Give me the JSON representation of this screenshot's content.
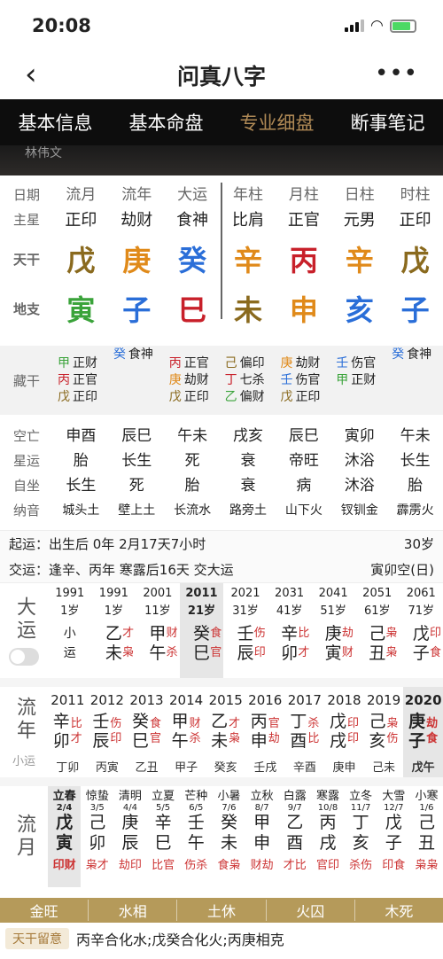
{
  "status": {
    "time": "20:08"
  },
  "nav": {
    "title": "问真八字"
  },
  "tabs": [
    "基本信息",
    "基本命盘",
    "专业细盘",
    "断事笔记"
  ],
  "banner": {
    "name": "林伟文"
  },
  "header": {
    "labels": [
      "日期",
      "流月",
      "流年",
      "大运",
      "年柱",
      "月柱",
      "日柱",
      "时柱"
    ]
  },
  "zhuxing": {
    "label": "主星",
    "values": [
      "正印",
      "劫财",
      "食神",
      "比肩",
      "正官",
      "元男",
      "正印"
    ]
  },
  "tiangan": {
    "label": "天干",
    "values": [
      "戊",
      "庚",
      "癸",
      "辛",
      "丙",
      "辛",
      "戊"
    ]
  },
  "dizhi": {
    "label": "地支",
    "values": [
      "寅",
      "子",
      "巳",
      "未",
      "申",
      "亥",
      "子"
    ]
  },
  "canggan": {
    "label": "藏干",
    "cols": [
      [
        [
          "甲",
          "正财"
        ],
        [
          "丙",
          "正官"
        ],
        [
          "戊",
          "正印"
        ]
      ],
      [
        [
          "癸",
          "食神"
        ]
      ],
      [
        [
          "丙",
          "正官"
        ],
        [
          "庚",
          "劫财"
        ],
        [
          "戊",
          "正印"
        ]
      ],
      [
        [
          "己",
          "偏印"
        ],
        [
          "丁",
          "七杀"
        ],
        [
          "乙",
          "偏财"
        ]
      ],
      [
        [
          "庚",
          "劫财"
        ],
        [
          "壬",
          "伤官"
        ],
        [
          "戊",
          "正印"
        ]
      ],
      [
        [
          "壬",
          "伤官"
        ],
        [
          "甲",
          "正财"
        ]
      ],
      [
        [
          "癸",
          "食神"
        ]
      ]
    ]
  },
  "kongwang": {
    "label": "空亡",
    "values": [
      "申酉",
      "辰巳",
      "午未",
      "戌亥",
      "辰巳",
      "寅卯",
      "午未"
    ]
  },
  "xingyun": {
    "label": "星运",
    "values": [
      "胎",
      "长生",
      "死",
      "衰",
      "帝旺",
      "沐浴",
      "长生"
    ]
  },
  "zizuo": {
    "label": "自坐",
    "values": [
      "长生",
      "死",
      "胎",
      "衰",
      "病",
      "沐浴",
      "胎"
    ]
  },
  "nayin": {
    "label": "纳音",
    "values": [
      "城头土",
      "壁上土",
      "长流水",
      "路旁土",
      "山下火",
      "钗钏金",
      "霹雳火"
    ]
  },
  "qiyun": {
    "line1": "起运：出生后 0年 2月17天7小时",
    "age": "30岁",
    "line2": "交运：逢辛、丙年 寒露后16天 交大运",
    "kong": "寅卯空(日)"
  },
  "dayun": {
    "title": "大运",
    "items": [
      {
        "year": "1991",
        "age": "1岁",
        "g": "小",
        "z": "运",
        "sg": "",
        "sz": ""
      },
      {
        "year": "1991",
        "age": "1岁",
        "g": "乙",
        "z": "未",
        "sg": "才",
        "sz": "枭"
      },
      {
        "year": "2001",
        "age": "11岁",
        "g": "甲",
        "z": "午",
        "sg": "财",
        "sz": "杀"
      },
      {
        "year": "2011",
        "age": "21岁",
        "g": "癸",
        "z": "巳",
        "sg": "食",
        "sz": "官"
      },
      {
        "year": "2021",
        "age": "31岁",
        "g": "壬",
        "z": "辰",
        "sg": "伤",
        "sz": "印"
      },
      {
        "year": "2031",
        "age": "41岁",
        "g": "辛",
        "z": "卯",
        "sg": "比",
        "sz": "才"
      },
      {
        "year": "2041",
        "age": "51岁",
        "g": "庚",
        "z": "寅",
        "sg": "劫",
        "sz": "财"
      },
      {
        "year": "2051",
        "age": "61岁",
        "g": "己",
        "z": "丑",
        "sg": "枭",
        "sz": "枭"
      },
      {
        "year": "2061",
        "age": "71岁",
        "g": "戊",
        "z": "子",
        "sg": "印",
        "sz": "食"
      }
    ]
  },
  "liunian": {
    "title": "流年",
    "sub": "小运",
    "items": [
      {
        "year": "2011",
        "g": "辛",
        "z": "卯",
        "sg": "比",
        "sz": "才",
        "x": "丁卯"
      },
      {
        "year": "2012",
        "g": "壬",
        "z": "辰",
        "sg": "伤",
        "sz": "印",
        "x": "丙寅"
      },
      {
        "year": "2013",
        "g": "癸",
        "z": "巳",
        "sg": "食",
        "sz": "官",
        "x": "乙丑"
      },
      {
        "year": "2014",
        "g": "甲",
        "z": "午",
        "sg": "财",
        "sz": "杀",
        "x": "甲子"
      },
      {
        "year": "2015",
        "g": "乙",
        "z": "未",
        "sg": "才",
        "sz": "枭",
        "x": "癸亥"
      },
      {
        "year": "2016",
        "g": "丙",
        "z": "申",
        "sg": "官",
        "sz": "劫",
        "x": "壬戌"
      },
      {
        "year": "2017",
        "g": "丁",
        "z": "酉",
        "sg": "杀",
        "sz": "比",
        "x": "辛酉"
      },
      {
        "year": "2018",
        "g": "戊",
        "z": "戌",
        "sg": "印",
        "sz": "印",
        "x": "庚申"
      },
      {
        "year": "2019",
        "g": "己",
        "z": "亥",
        "sg": "枭",
        "sz": "伤",
        "x": "己未"
      },
      {
        "year": "2020",
        "g": "庚",
        "z": "子",
        "sg": "劫",
        "sz": "食",
        "x": "戊午"
      }
    ]
  },
  "liuyue": {
    "title": "流月",
    "items": [
      {
        "jie": "立春",
        "d": "2/4",
        "g": "戊",
        "z": "寅",
        "s": "印财"
      },
      {
        "jie": "惊蛰",
        "d": "3/5",
        "g": "己",
        "z": "卯",
        "s": "枭才"
      },
      {
        "jie": "清明",
        "d": "4/4",
        "g": "庚",
        "z": "辰",
        "s": "劫印"
      },
      {
        "jie": "立夏",
        "d": "5/5",
        "g": "辛",
        "z": "巳",
        "s": "比官"
      },
      {
        "jie": "芒种",
        "d": "6/5",
        "g": "壬",
        "z": "午",
        "s": "伤杀"
      },
      {
        "jie": "小暑",
        "d": "7/6",
        "g": "癸",
        "z": "未",
        "s": "食枭"
      },
      {
        "jie": "立秋",
        "d": "8/7",
        "g": "甲",
        "z": "申",
        "s": "财劫"
      },
      {
        "jie": "白露",
        "d": "9/7",
        "g": "乙",
        "z": "酉",
        "s": "才比"
      },
      {
        "jie": "寒露",
        "d": "10/8",
        "g": "丙",
        "z": "戌",
        "s": "官印"
      },
      {
        "jie": "立冬",
        "d": "11/7",
        "g": "丁",
        "z": "亥",
        "s": "杀伤"
      },
      {
        "jie": "大雪",
        "d": "12/7",
        "g": "戊",
        "z": "子",
        "s": "印食"
      },
      {
        "jie": "小寒",
        "d": "1/6",
        "g": "己",
        "z": "丑",
        "s": "枭枭"
      }
    ]
  },
  "wuxing": [
    "金旺",
    "水相",
    "土休",
    "火囚",
    "木死"
  ],
  "tiangan_note": {
    "badge": "天干留意",
    "text": "丙辛合化水;戊癸合化火;丙庚相克"
  }
}
